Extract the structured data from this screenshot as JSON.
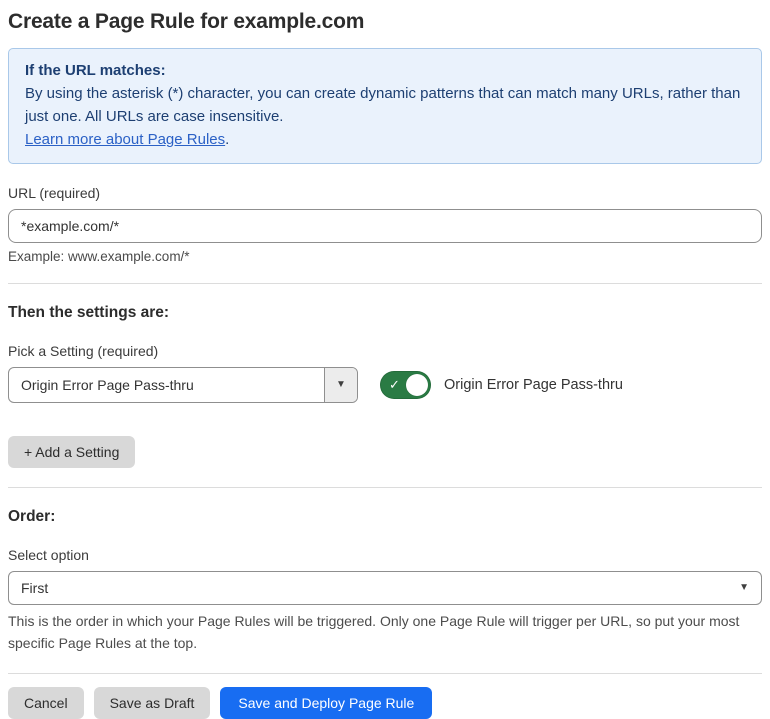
{
  "page": {
    "title": "Create a Page Rule for example.com"
  },
  "info_box": {
    "heading": "If the URL matches:",
    "body": "By using the asterisk (*) character, you can create dynamic patterns that can match many URLs, rather than just one. All URLs are case insensitive.",
    "link_label": "Learn more about Page Rules",
    "link_suffix": "."
  },
  "url_field": {
    "label": "URL (required)",
    "value": "*example.com/*",
    "helper": "Example: www.example.com/*"
  },
  "settings_section": {
    "heading": "Then the settings are:",
    "picker_label": "Pick a Setting (required)",
    "picker_value": "Origin Error Page Pass-thru",
    "toggle_state": "on",
    "toggle_label": "Origin Error Page Pass-thru",
    "add_button_label": "+ Add a Setting"
  },
  "order_section": {
    "heading": "Order:",
    "select_label": "Select option",
    "select_value": "First",
    "helper": "This is the order in which your Page Rules will be triggered. Only one Page Rule will trigger per URL, so put your most specific Page Rules at the top."
  },
  "footer": {
    "cancel_label": "Cancel",
    "save_draft_label": "Save as Draft",
    "save_deploy_label": "Save and Deploy Page Rule"
  },
  "glyphs": {
    "caret_down": "▼",
    "check": "✓"
  },
  "colors": {
    "accent_blue": "#186df2",
    "toggle_green": "#2a7b44",
    "info_bg": "#eaf2fc",
    "info_border": "#a9c8e9",
    "info_text": "#1d3f72",
    "link_blue": "#2b61c6",
    "button_gray": "#d8d8d8",
    "divider": "#dcdcdc"
  }
}
